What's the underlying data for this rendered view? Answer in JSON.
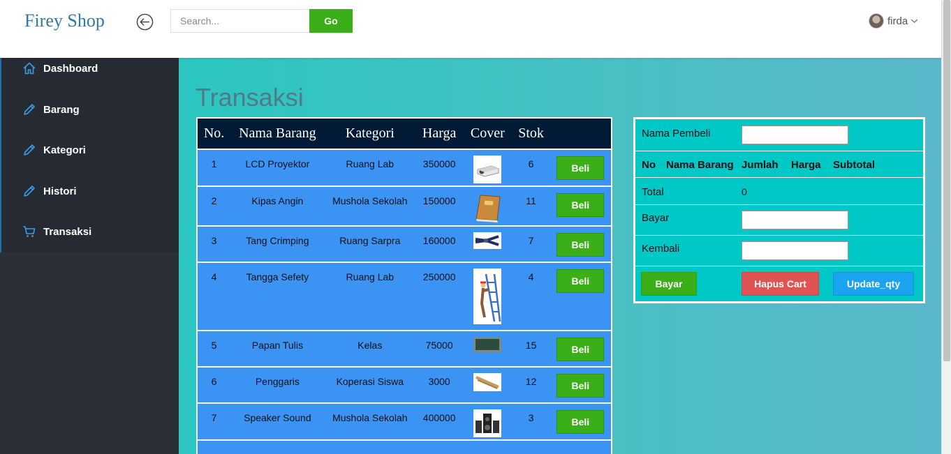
{
  "header": {
    "brand": "Firey Shop",
    "search_placeholder": "Search...",
    "go_label": "Go",
    "user_name": "firda"
  },
  "sidebar": {
    "items": [
      {
        "label": "Dashboard",
        "icon": "home-icon"
      },
      {
        "label": "Barang",
        "icon": "pencil-icon"
      },
      {
        "label": "Kategori",
        "icon": "pencil-icon"
      },
      {
        "label": "Histori",
        "icon": "pencil-icon"
      },
      {
        "label": "Transaksi",
        "icon": "cart-icon"
      }
    ]
  },
  "main": {
    "title": "Transaksi",
    "table": {
      "headers": [
        "No.",
        "Nama Barang",
        "Kategori",
        "Harga",
        "Cover",
        "Stok",
        ""
      ],
      "buy_label": "Beli",
      "rows": [
        {
          "no": "1",
          "nama": "LCD Proyektor",
          "kategori": "Ruang Lab",
          "harga": "350000",
          "cover": "projector-image",
          "stok": "6"
        },
        {
          "no": "2",
          "nama": "Kipas Angin",
          "kategori": "Mushola Sekolah",
          "harga": "150000",
          "cover": "book-image",
          "stok": "11"
        },
        {
          "no": "3",
          "nama": "Tang Crimping",
          "kategori": "Ruang Sarpra",
          "harga": "160000",
          "cover": "crimping-tool-image",
          "stok": "7"
        },
        {
          "no": "4",
          "nama": "Tangga Sefety",
          "kategori": "Ruang Lab",
          "harga": "250000",
          "cover": "ladder-image",
          "stok": "4"
        },
        {
          "no": "5",
          "nama": "Papan Tulis",
          "kategori": "Kelas",
          "harga": "75000",
          "cover": "blackboard-image",
          "stok": "15"
        },
        {
          "no": "6",
          "nama": "Penggaris",
          "kategori": "Koperasi Siswa",
          "harga": "3000",
          "cover": "ruler-image",
          "stok": "12"
        },
        {
          "no": "7",
          "nama": "Speaker Sound",
          "kategori": "Mushola Sekolah",
          "harga": "400000",
          "cover": "speaker-image",
          "stok": "3"
        }
      ]
    }
  },
  "cart": {
    "nama_pembeli_label": "Nama Pembeli",
    "headers": {
      "no": "No",
      "nama": "Nama Barang",
      "jumlah": "Jumlah",
      "harga": "Harga",
      "subtotal": "Subtotal"
    },
    "total_label": "Total",
    "total_value": "0",
    "bayar_label": "Bayar",
    "kembali_label": "Kembali",
    "buttons": {
      "bayar": "Bayar",
      "hapus": "Hapus Cart",
      "update": "Update_qty"
    },
    "colors": {
      "bayar": "#3aaf17",
      "hapus": "#e05353",
      "update": "#1aa3ef"
    }
  }
}
